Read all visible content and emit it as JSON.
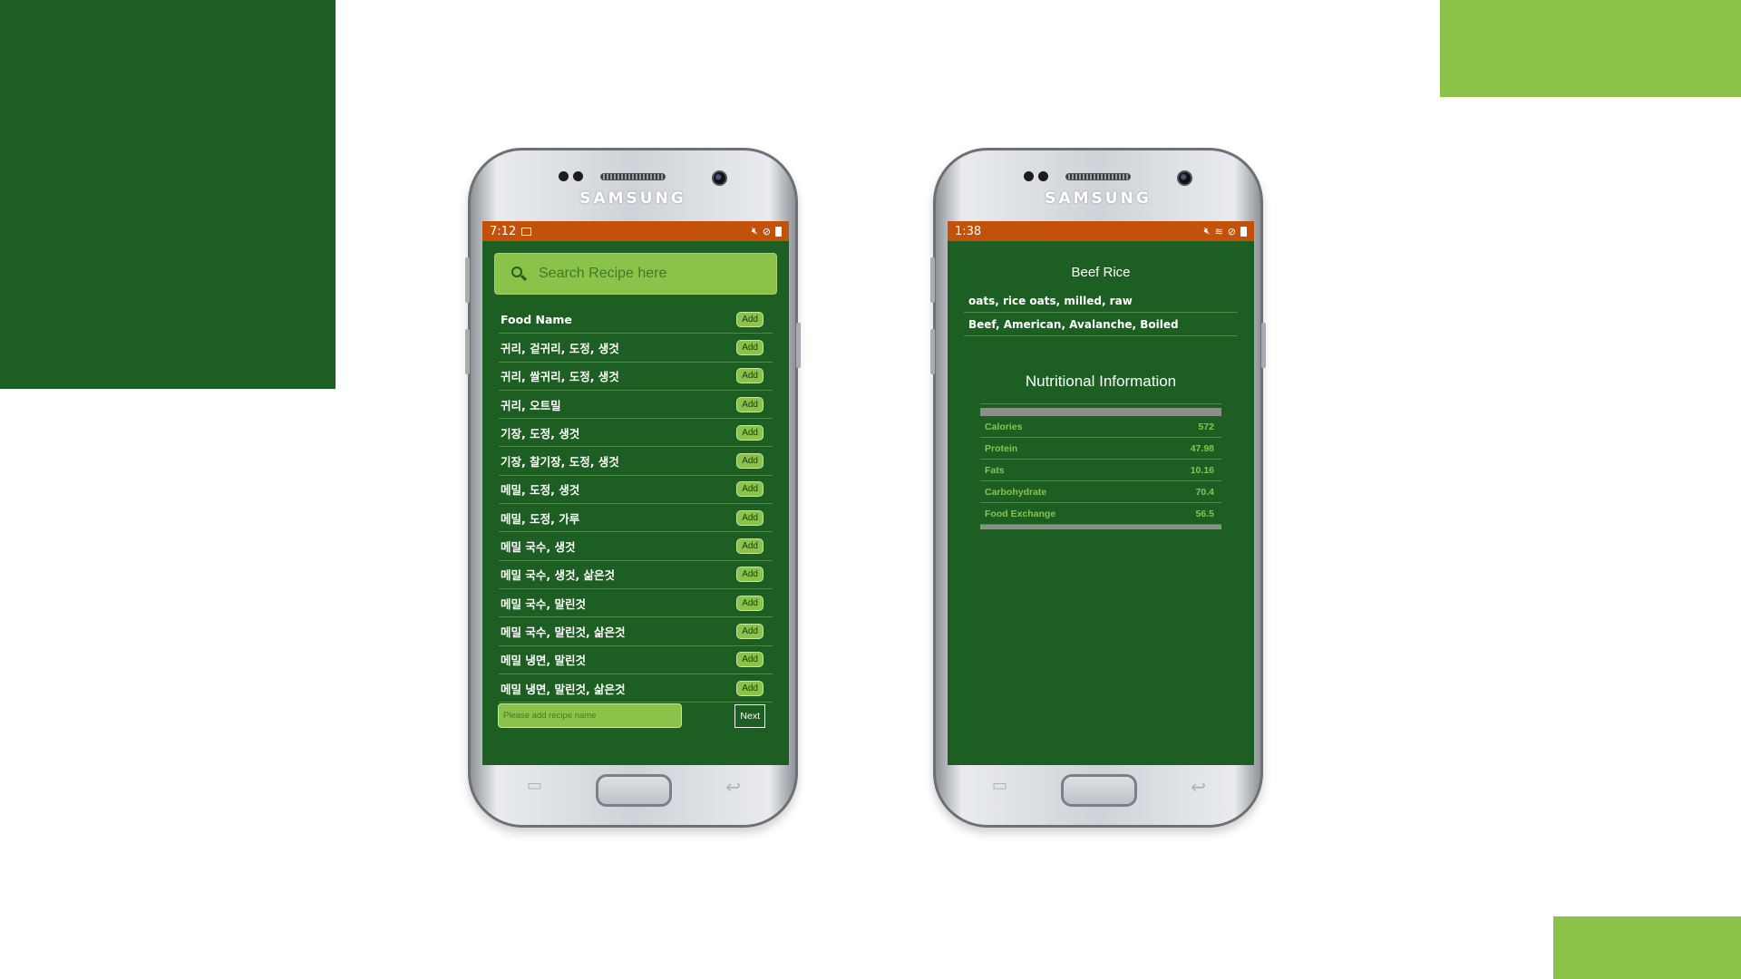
{
  "colors": {
    "dark_green": "#1d5e22",
    "light_green": "#8bc34a",
    "status_orange": "#c2510a"
  },
  "phones": {
    "brand": "SAMSUNG"
  },
  "left_screen": {
    "status": {
      "time": "7:12"
    },
    "search": {
      "placeholder": "Search Recipe here"
    },
    "list_header": {
      "label": "Food Name",
      "add_label": "Add"
    },
    "foods": [
      {
        "name": "귀리, 겉귀리, 도정, 생것",
        "add_label": "Add"
      },
      {
        "name": "귀리, 쌀귀리, 도정, 생것",
        "add_label": "Add"
      },
      {
        "name": "귀리, 오트밀",
        "add_label": "Add"
      },
      {
        "name": "기장, 도정, 생것",
        "add_label": "Add"
      },
      {
        "name": "기장, 찰기장, 도정, 생것",
        "add_label": "Add"
      },
      {
        "name": "메밀, 도정, 생것",
        "add_label": "Add"
      },
      {
        "name": "메밀, 도정, 가루",
        "add_label": "Add"
      },
      {
        "name": "메밀 국수, 생것",
        "add_label": "Add"
      },
      {
        "name": "메밀 국수, 생것, 삶은것",
        "add_label": "Add"
      },
      {
        "name": "메밀 국수, 말린것",
        "add_label": "Add"
      },
      {
        "name": "메밀 국수, 말린것, 삶은것",
        "add_label": "Add"
      },
      {
        "name": "메밀 냉면, 말린것",
        "add_label": "Add"
      },
      {
        "name": "메밀 냉면, 말린것, 삶은것",
        "add_label": "Add"
      }
    ],
    "recipe_input": {
      "placeholder": "Please add recipe name"
    },
    "next_label": "Next"
  },
  "right_screen": {
    "status": {
      "time": "1:38"
    },
    "recipe_title": "Beef Rice",
    "ingredients": [
      "oats, rice oats, milled, raw",
      "Beef, American, Avalanche, Boiled"
    ],
    "nutrition_title": "Nutritional Information",
    "nutrition": [
      {
        "label": "Calories",
        "value": "572"
      },
      {
        "label": "Protein",
        "value": "47.98"
      },
      {
        "label": "Fats",
        "value": "10.16"
      },
      {
        "label": "Carbohydrate",
        "value": "70.4"
      },
      {
        "label": "Food Exchange",
        "value": "56.5"
      }
    ]
  }
}
